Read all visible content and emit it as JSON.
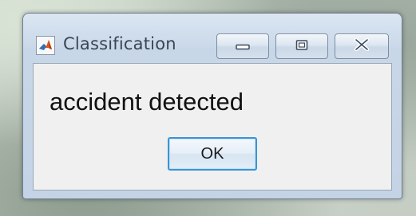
{
  "window": {
    "title": "Classification",
    "icon": "matlab-icon"
  },
  "title_controls": {
    "minimize_icon": "minimize-icon",
    "maximize_icon": "restore-icon",
    "close_icon": "close-icon"
  },
  "dialog": {
    "message": "accident detected",
    "ok_label": "OK"
  },
  "colors": {
    "ok_focus_border": "#3c94d4",
    "client_background": "#f0f0f0",
    "frame": "#c8d7e8"
  }
}
